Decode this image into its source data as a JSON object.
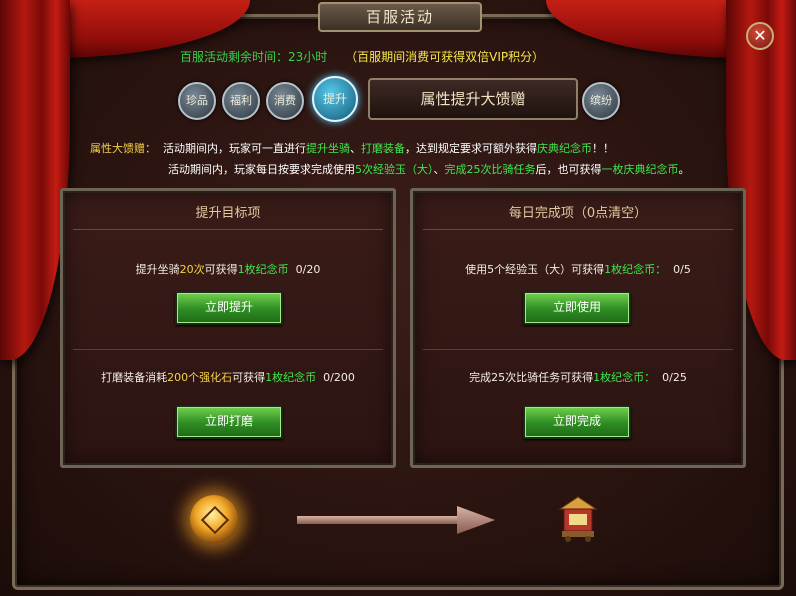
{
  "window": {
    "title": "百服活动",
    "close_label": "✕"
  },
  "status": {
    "remaining": "百服活动剩余时间：23小时",
    "bonus": "（百服期间消费可获得双倍VIP积分）"
  },
  "tabs": [
    {
      "label": "珍品"
    },
    {
      "label": "福利"
    },
    {
      "label": "消费"
    },
    {
      "label": "提升"
    },
    {
      "label": "缤纷"
    }
  ],
  "banner": {
    "title": "属性提升大馈赠"
  },
  "description": {
    "label": "属性大馈赠：",
    "line1": {
      "t1": "活动期间内，玩家可一直进行",
      "h1": "提升坐骑",
      "sep": "、",
      "h2": "打磨装备",
      "t2": "，达到规定要求可额外获得",
      "h3": "庆典纪念币",
      "t3": "！！"
    },
    "line2": {
      "t1": "活动期间内，玩家每日按要求完成使用",
      "h1": "5次经验玉（大）",
      "sep": "、",
      "h2": "完成25次比骑任务",
      "t2": "后，也可获得",
      "h3": "一枚庆典纪念币",
      "t3": "。"
    }
  },
  "panels": {
    "left": {
      "title": "提升目标项",
      "items": [
        {
          "pre": "提升坐骑",
          "n": "20次",
          "mid": "可获得",
          "reward": "1枚纪念币",
          "progress": "0/20",
          "button": "立即提升"
        },
        {
          "pre": "打磨装备消耗",
          "n": "200个强化石",
          "mid": "可获得",
          "reward": "1枚纪念币",
          "progress": "0/200",
          "button": "立即打磨"
        }
      ]
    },
    "right": {
      "title": "每日完成项（0点清空）",
      "items": [
        {
          "pre": "使用5个经验玉（大）可获得",
          "reward": "1枚纪念币：",
          "progress": "0/5",
          "button": "立即使用"
        },
        {
          "pre": "完成25次比骑任务可获得",
          "reward": "1枚纪念币：",
          "progress": "0/25",
          "button": "立即完成"
        }
      ]
    }
  },
  "colors": {
    "highlight_green": "#3fe84e",
    "highlight_yellow": "#f4d24a",
    "button_green": "#2d8c23"
  }
}
